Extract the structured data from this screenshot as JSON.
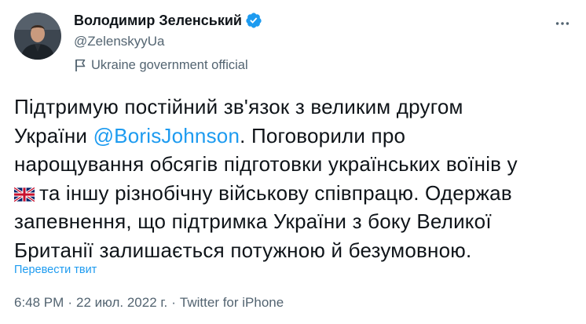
{
  "author": {
    "display_name": "Володимир Зеленський",
    "handle": "@ZelenskyyUa",
    "label": "Ukraine government official"
  },
  "tweet": {
    "line1": "Підтримую постійний зв'язок з великим другом",
    "line2_prefix": "України ",
    "mention": "@BorisJohnson",
    "line2_suffix": ". Поговорили про",
    "line3": "нарощування обсягів підготовки українських воїнів у",
    "line4": "та іншу різнобічну військову співпрацю. Одержав",
    "line5": "запевнення, що підтримка України з боку Великої",
    "line6": "Британії залишається потужною й безумовною."
  },
  "translate_label": "Перевести твит",
  "meta": {
    "time": "6:48 PM",
    "separator": "·",
    "date": "22 июл. 2022 г.",
    "source": "Twitter for iPhone"
  },
  "icons": {
    "verified": "verified-badge-icon",
    "government": "government-flag-icon",
    "more": "more-options-icon",
    "uk_flag": "uk-flag-emoji"
  },
  "colors": {
    "accent": "#1d9bf0",
    "secondary_text": "#536471",
    "primary_text": "#0f1419"
  }
}
